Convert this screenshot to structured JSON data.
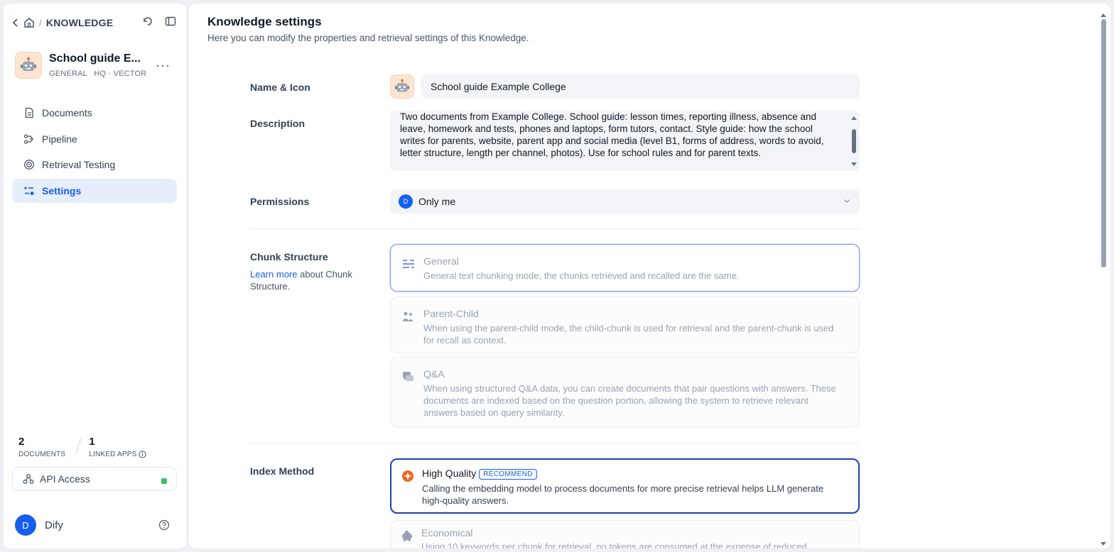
{
  "breadcrumb": {
    "section": "KNOWLEDGE"
  },
  "knowledge": {
    "name": "School guide E...",
    "meta": "GENERAL   HQ · VECTOR"
  },
  "nav": {
    "items": [
      {
        "label": "Documents",
        "icon": "document-icon"
      },
      {
        "label": "Pipeline",
        "icon": "pipeline-icon"
      },
      {
        "label": "Retrieval Testing",
        "icon": "target-icon"
      },
      {
        "label": "Settings",
        "icon": "settings-sliders-icon",
        "active": true
      }
    ]
  },
  "stats": {
    "documents": {
      "value": "2",
      "label": "DOCUMENTS"
    },
    "linked_apps": {
      "value": "1",
      "label": "LINKED APPS"
    }
  },
  "api": {
    "label": "API Access",
    "status_color": "#3ac066"
  },
  "user": {
    "initial": "D",
    "name": "Dify"
  },
  "page": {
    "title": "Knowledge settings",
    "subtitle": "Here you can modify the properties and retrieval settings of this Knowledge."
  },
  "form": {
    "name_label": "Name & Icon",
    "name_value": "School guide Example College",
    "description_label": "Description",
    "description_value": "Two documents from Example College. School guide: lesson times, reporting illness, absence and leave, homework and tests, phones and laptops, form tutors, contact. Style guide: how the school writes for parents, website, parent app and social media (level B1, forms of address, words to avoid, letter structure, length per channel, photos). Use for school rules and for parent texts.",
    "permissions_label": "Permissions",
    "permissions_initial": "D",
    "permissions_value": "Only me",
    "chunk_label": "Chunk Structure",
    "chunk_learn_link": "Learn more",
    "chunk_learn_rest": " about Chunk Structure.",
    "chunk_options": [
      {
        "title": "General",
        "desc": "General text chunking mode, the chunks retrieved and recalled are the same."
      },
      {
        "title": "Parent-Child",
        "desc": "When using the parent-child mode, the child-chunk is used for retrieval and the parent-chunk is used for recall as context."
      },
      {
        "title": "Q&A",
        "desc": "When using structured Q&A data, you can create documents that pair questions with answers. These documents are indexed based on the question portion, allowing the system to retrieve relevant answers based on query similarity."
      }
    ],
    "index_label": "Index Method",
    "index_options": [
      {
        "title": "High Quality",
        "badge": "RECOMMEND",
        "desc": "Calling the embedding model to process documents for more precise retrieval helps LLM generate high-quality answers."
      },
      {
        "title": "Economical",
        "desc": "Using 10 keywords per chunk for retrieval, no tokens are consumed at the expense of reduced"
      }
    ]
  },
  "colors": {
    "accent": "#155eef",
    "active_nav_bg": "#e6edfb"
  }
}
